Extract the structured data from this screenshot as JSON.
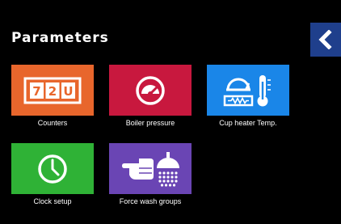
{
  "header": {
    "title": "Parameters",
    "back_icon": "chevron-left-icon"
  },
  "colors": {
    "background": "#000000",
    "back_button": "#1f3f8c",
    "counters": "#e8662c",
    "boiler": "#c8183e",
    "cup_heater": "#1a86e8",
    "clock": "#2fb236",
    "force_wash": "#6a45b4"
  },
  "tiles": {
    "counters": {
      "label": "Counters",
      "icon": "counter-display-icon",
      "digits": [
        "7",
        "2",
        "U"
      ]
    },
    "boiler": {
      "label": "Boiler pressure",
      "icon": "pressure-gauge-icon"
    },
    "cup_heater": {
      "label": "Cup heater Temp.",
      "icon": "cup-heater-thermometer-icon"
    },
    "clock": {
      "label": "Clock setup",
      "icon": "clock-icon"
    },
    "force_wash": {
      "label": "Force wash groups",
      "icon": "hand-pointing-shower-icon"
    }
  }
}
